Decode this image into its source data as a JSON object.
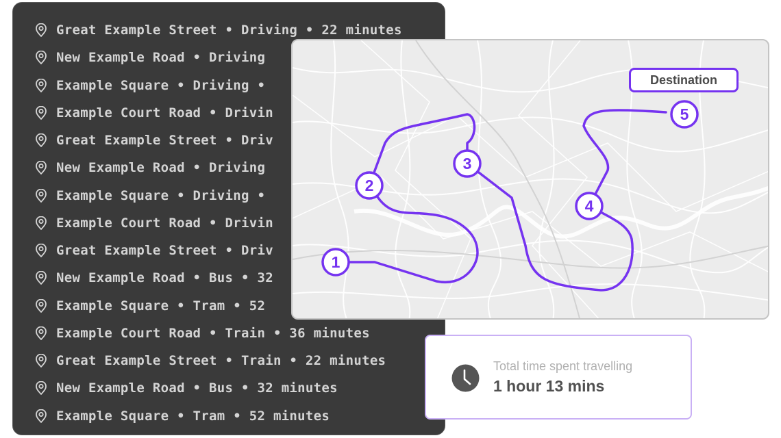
{
  "trip_list": {
    "items": [
      {
        "label": "Great Example Street • Driving • 22 minutes"
      },
      {
        "label": "New Example Road • Driving"
      },
      {
        "label": "Example Square • Driving •"
      },
      {
        "label": "Example Court Road • Drivin"
      },
      {
        "label": "Great Example Street • Driv"
      },
      {
        "label": "New Example Road • Driving"
      },
      {
        "label": "Example Square • Driving •"
      },
      {
        "label": "Example Court Road • Drivin"
      },
      {
        "label": "Great Example Street • Driv"
      },
      {
        "label": "New Example Road • Bus • 32"
      },
      {
        "label": "Example Square • Tram • 52"
      },
      {
        "label": "Example Court Road • Train • 36 minutes"
      },
      {
        "label": "Great Example Street • Train • 22 minutes"
      },
      {
        "label": "New Example Road • Bus • 32 minutes"
      },
      {
        "label": "Example Square • Tram • 52 minutes"
      }
    ],
    "item_icon": "map-pin-icon"
  },
  "map": {
    "route_color": "#7533f0",
    "stops": [
      {
        "label": "1"
      },
      {
        "label": "2"
      },
      {
        "label": "3"
      },
      {
        "label": "4"
      },
      {
        "label": "5"
      }
    ],
    "destination_label": "Destination"
  },
  "summary": {
    "icon": "clock-icon",
    "caption": "Total time spent travelling",
    "value": "1 hour 13 mins"
  }
}
